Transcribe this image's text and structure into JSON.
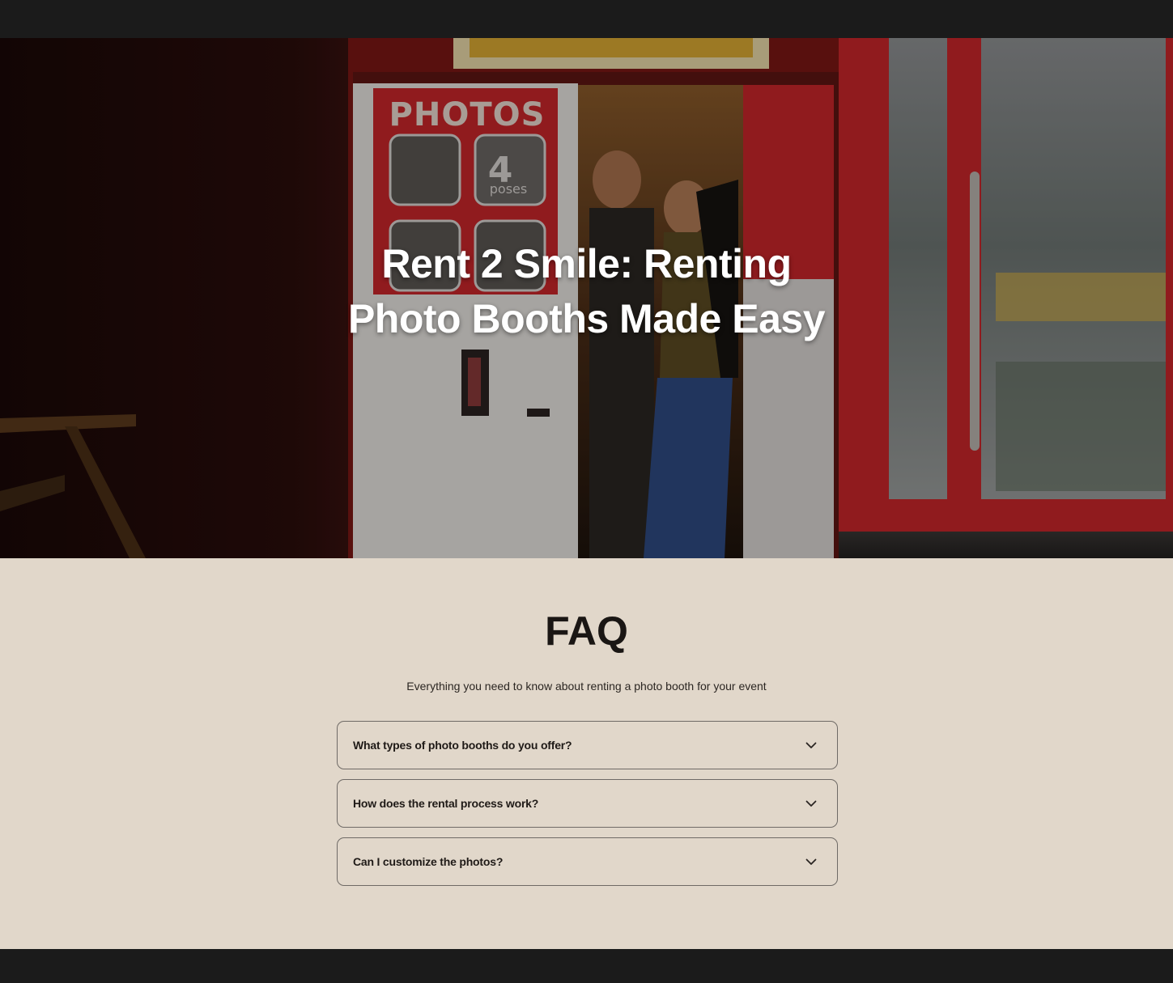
{
  "hero": {
    "title_line1": "Rent 2 Smile: Renting",
    "title_line2": "Photo Booths Made Easy",
    "booth_sign_text": "PHOTOS",
    "booth_panel_text": "4",
    "booth_panel_subtext": "poses"
  },
  "faq": {
    "title": "FAQ",
    "subtitle": "Everything you need to know about renting a photo booth for your event",
    "items": [
      {
        "question": "What types of photo booths do you offer?"
      },
      {
        "question": "How does the rental process work?"
      },
      {
        "question": "Can I customize the photos?"
      }
    ]
  },
  "colors": {
    "page_frame": "#1b1b1b",
    "faq_background": "#e1d7ca",
    "faq_border": "#6f6a66",
    "booth_red": "#c8262a",
    "text_dark": "#1a1614"
  },
  "icons": {
    "faq_toggle": "chevron-down-icon"
  }
}
